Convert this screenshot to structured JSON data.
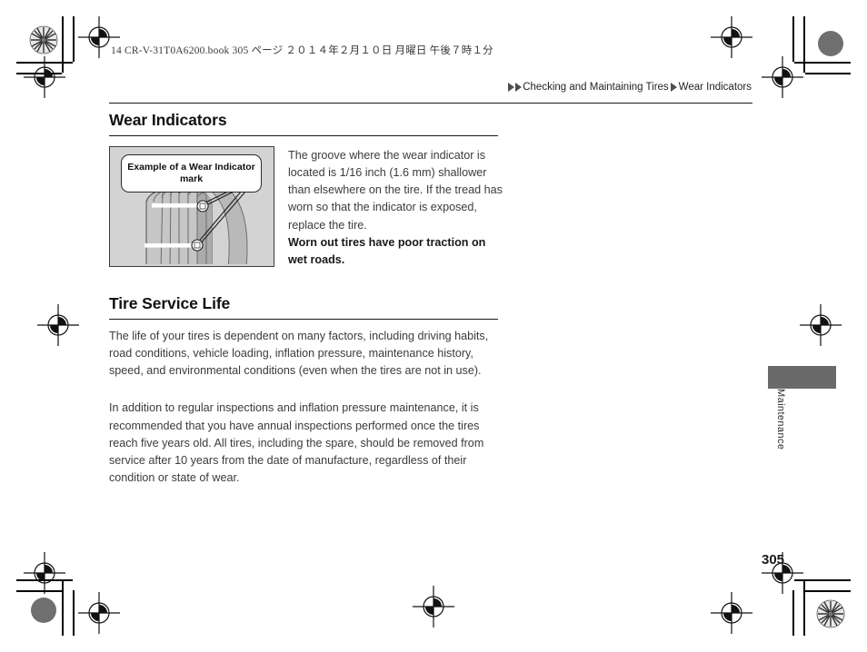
{
  "print_header": "14 CR-V-31T0A6200.book   305 ページ   ２０１４年２月１０日   月曜日   午後７時１分",
  "breadcrumb": {
    "first_icon": "triangle-right-icon",
    "second_icon": "triangle-right-icon",
    "parent": "Checking and Maintaining Tires",
    "separator_icon": "triangle-right-icon",
    "current": "Wear Indicators"
  },
  "sections": [
    {
      "title": "Wear Indicators",
      "figure": {
        "callout": "Example of a Wear Indicator mark",
        "alt": "tire-wear-indicator-illustration"
      },
      "paragraphs": [
        {
          "text": "The groove where the wear indicator is located is 1/16 inch (1.6 mm) shallower than elsewhere on the tire. If the tread has worn so that the indicator is exposed, replace the tire.",
          "bold": false
        },
        {
          "text": "Worn out tires have poor traction on wet roads.",
          "bold": true
        }
      ]
    },
    {
      "title": "Tire Service Life",
      "paragraphs": [
        {
          "text": "The life of your tires is dependent on many factors, including driving habits, road conditions, vehicle loading, inflation pressure, maintenance history, speed, and environmental conditions (even when the tires are not in use).",
          "bold": false
        },
        {
          "text": "In addition to regular inspections and inflation pressure maintenance, it is recommended that you have annual inspections performed once the tires reach five years old. All tires, including the spare, should be removed from service after 10 years from the date of manufacture, regardless of their condition or state of wear.",
          "bold": false
        }
      ]
    }
  ],
  "side_tab": {
    "label": "Maintenance",
    "color": "#6a6a6a"
  },
  "page_number": "305",
  "colors": {
    "text": "#3b3b3b",
    "heading": "#111111",
    "figure_background": "#d3d3d3",
    "rule": "#1a1a1a"
  }
}
